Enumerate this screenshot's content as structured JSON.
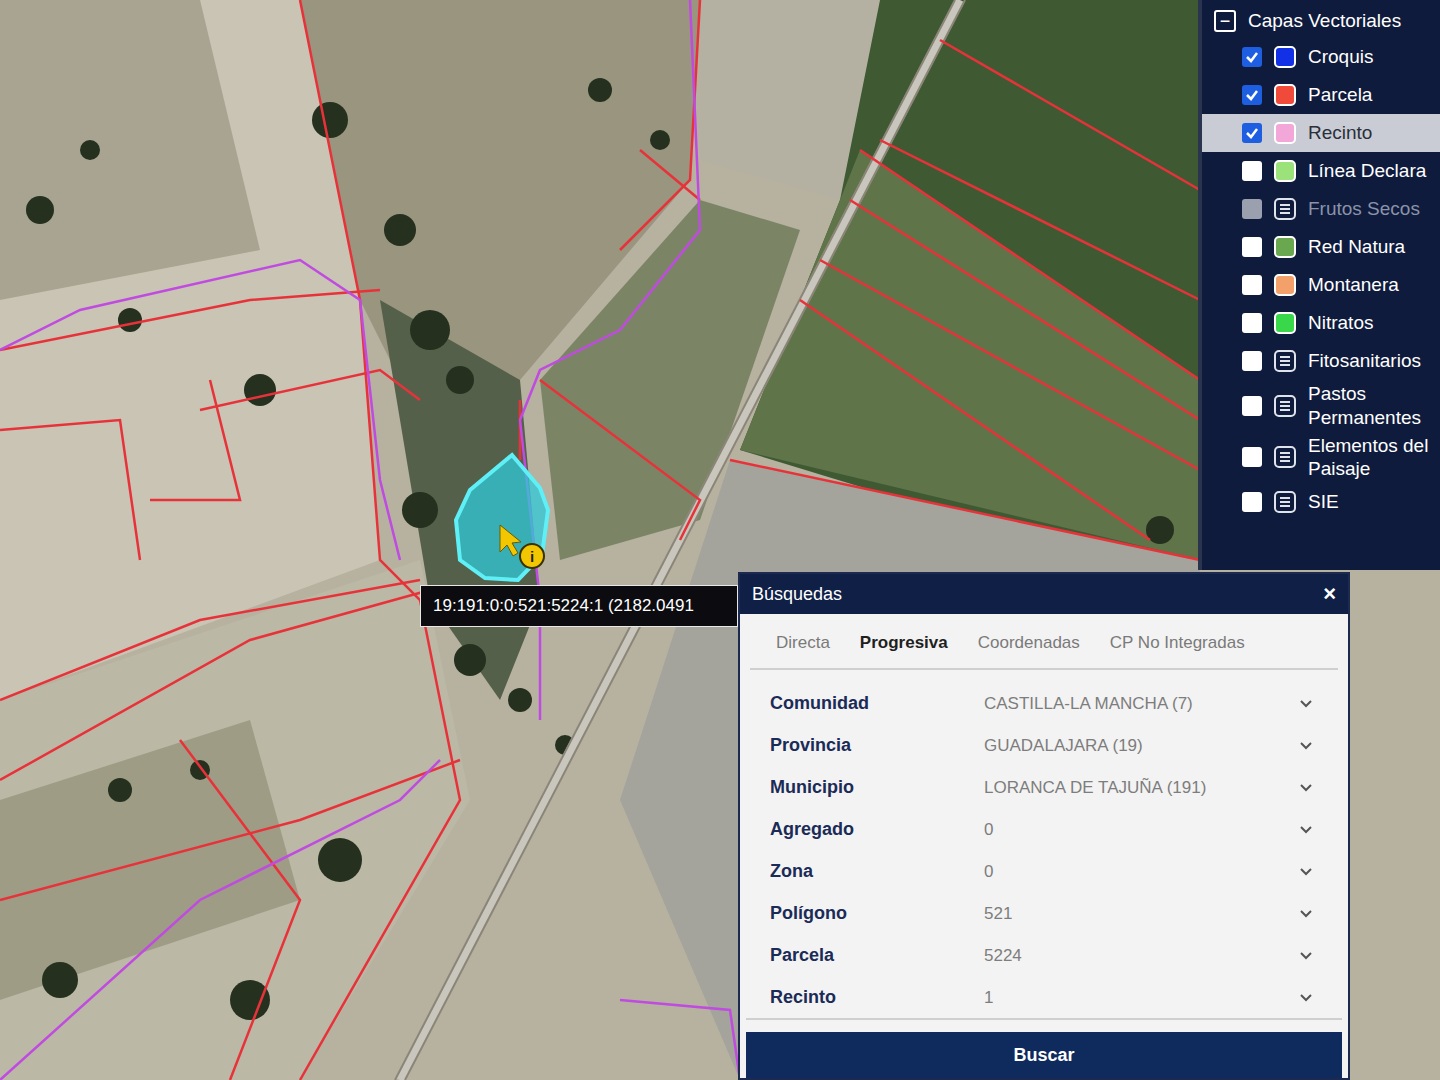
{
  "map": {
    "tooltip": "19:191:0:0:521:5224:1 (2182.0491",
    "info_marker": "i"
  },
  "layers_panel": {
    "title": "Capas Vectoriales",
    "collapse": "−",
    "items": [
      {
        "label": "Croquis",
        "kind": "swatch",
        "color": "#1230e6",
        "checked": true,
        "selected": false,
        "disabled": false
      },
      {
        "label": "Parcela",
        "kind": "swatch",
        "color": "#f04a3a",
        "checked": true,
        "selected": false,
        "disabled": false
      },
      {
        "label": "Recinto",
        "kind": "swatch",
        "color": "#f3a6d8",
        "checked": true,
        "selected": true,
        "disabled": false
      },
      {
        "label": "Línea Declara",
        "kind": "swatch",
        "color": "#9be27a",
        "checked": false,
        "selected": false,
        "disabled": false
      },
      {
        "label": "Frutos Secos",
        "kind": "list",
        "checked": false,
        "selected": false,
        "disabled": true
      },
      {
        "label": "Red Natura",
        "kind": "swatch",
        "color": "#6aa84f",
        "checked": false,
        "selected": false,
        "disabled": false
      },
      {
        "label": "Montanera",
        "kind": "swatch",
        "color": "#f4a06a",
        "checked": false,
        "selected": false,
        "disabled": false
      },
      {
        "label": "Nitratos",
        "kind": "swatch",
        "color": "#39d84a",
        "checked": false,
        "selected": false,
        "disabled": false
      },
      {
        "label": "Fitosanitarios",
        "kind": "list",
        "checked": false,
        "selected": false,
        "disabled": false
      },
      {
        "label": "Pastos Permanentes",
        "kind": "list",
        "checked": false,
        "selected": false,
        "disabled": false
      },
      {
        "label": "Elementos del Paisaje",
        "kind": "list",
        "checked": false,
        "selected": false,
        "disabled": false
      },
      {
        "label": "SIE",
        "kind": "list",
        "checked": false,
        "selected": false,
        "disabled": false
      }
    ]
  },
  "search": {
    "title": "Búsquedas",
    "close": "×",
    "tabs": [
      {
        "label": "Directa",
        "selected": false
      },
      {
        "label": "Progresiva",
        "selected": true
      },
      {
        "label": "Coordenadas",
        "selected": false
      },
      {
        "label": "CP No Integradas",
        "selected": false
      }
    ],
    "fields": [
      {
        "label": "Comunidad",
        "value": "CASTILLA-LA MANCHA (7)"
      },
      {
        "label": "Provincia",
        "value": "GUADALAJARA (19)"
      },
      {
        "label": "Municipio",
        "value": "LORANCA DE TAJUÑA (191)"
      },
      {
        "label": "Agregado",
        "value": "0"
      },
      {
        "label": "Zona",
        "value": "0"
      },
      {
        "label": "Polígono",
        "value": "521"
      },
      {
        "label": "Parcela",
        "value": "5224"
      },
      {
        "label": "Recinto",
        "value": "1"
      }
    ],
    "button": "Buscar"
  }
}
